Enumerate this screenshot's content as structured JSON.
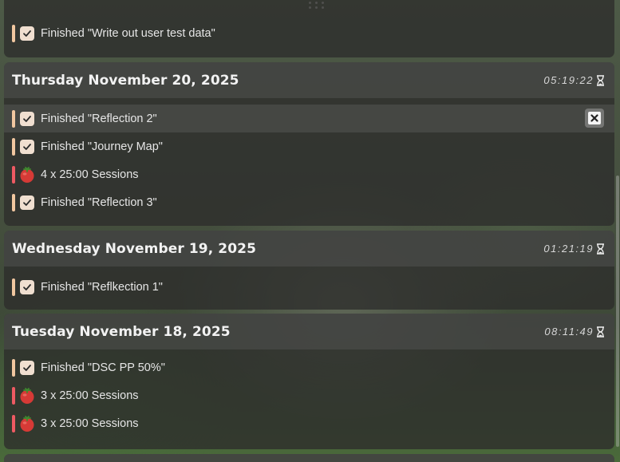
{
  "top_card": {
    "entries": [
      {
        "type": "task",
        "text": "Finished \"Write out user test data\""
      }
    ]
  },
  "days": [
    {
      "date": "Thursday November 20, 2025",
      "duration": "05:19:22",
      "entries": [
        {
          "type": "task",
          "text": "Finished \"Reflection 2\""
        },
        {
          "type": "task",
          "text": "Finished \"Journey Map\""
        },
        {
          "type": "pomodoro",
          "text": "4 x 25:00 Sessions"
        },
        {
          "type": "task",
          "text": "Finished \"Reflection 3\""
        }
      ]
    },
    {
      "date": "Wednesday November 19, 2025",
      "duration": "01:21:19",
      "entries": [
        {
          "type": "task",
          "text": "Finished \"Reflkection 1\""
        }
      ]
    },
    {
      "date": "Tuesday November 18, 2025",
      "duration": "08:11:49",
      "entries": [
        {
          "type": "task",
          "text": "Finished \"DSC PP 50%\""
        },
        {
          "type": "pomodoro",
          "text": "3 x 25:00 Sessions"
        },
        {
          "type": "pomodoro",
          "text": "3 x 25:00 Sessions"
        }
      ]
    }
  ],
  "icons": {
    "task": "checkbox-icon",
    "pomodoro": "tomato-icon",
    "duration": "hourglass-icon",
    "delete": "close-icon",
    "drag": "drag-handle-icon"
  },
  "colors": {
    "task_accent": "#f1c7a0",
    "pomodoro_accent": "#ee5a63"
  }
}
